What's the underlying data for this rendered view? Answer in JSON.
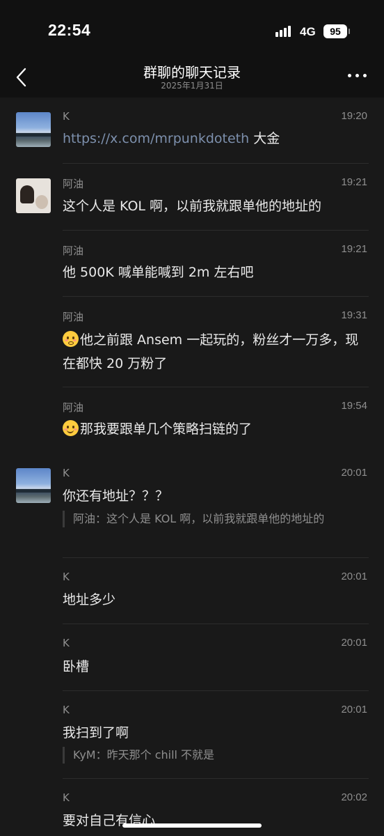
{
  "status_bar": {
    "time": "22:54",
    "network": "4G",
    "battery": "95"
  },
  "nav": {
    "title": "群聊的聊天记录",
    "subtitle": "2025年1月31日"
  },
  "messages": [
    {
      "sender": "K",
      "time": "19:20",
      "link": "https://x.com/mrpunkdoteth",
      "text": " 大金"
    },
    {
      "sender": "阿油",
      "time": "19:21",
      "text": "这个人是 KOL 啊，以前我就跟单他的地址的"
    },
    {
      "sender": "阿油",
      "time": "19:21",
      "text": "他 500K 喊单能喊到 2m 左右吧"
    },
    {
      "sender": "阿油",
      "time": "19:31",
      "emoji": "flushed-face",
      "text": "他之前跟 Ansem 一起玩的，粉丝才一万多，现在都快 20 万粉了"
    },
    {
      "sender": "阿油",
      "time": "19:54",
      "emoji": "smiling-face",
      "text": "那我要跟单几个策略扫链的了"
    },
    {
      "sender": "K",
      "time": "20:01",
      "text": "你还有地址？？？",
      "quote": "阿油：这个人是 KOL 啊，以前我就跟单他的地址的"
    },
    {
      "sender": "K",
      "time": "20:01",
      "text": "地址多少"
    },
    {
      "sender": "K",
      "time": "20:01",
      "text": "卧槽"
    },
    {
      "sender": "K",
      "time": "20:01",
      "text": "我扫到了啊",
      "quote": "KyM：昨天那个 chill 不就是"
    },
    {
      "sender": "K",
      "time": "20:02",
      "text": "要对自己有信心"
    }
  ],
  "colors": {
    "background": "#191919",
    "header": "#111111",
    "link": "#7d90ad",
    "muted": "#8f8f8f"
  },
  "icons": [
    "back-chevron-icon",
    "more-dots-icon",
    "signal-icon",
    "battery-icon"
  ]
}
